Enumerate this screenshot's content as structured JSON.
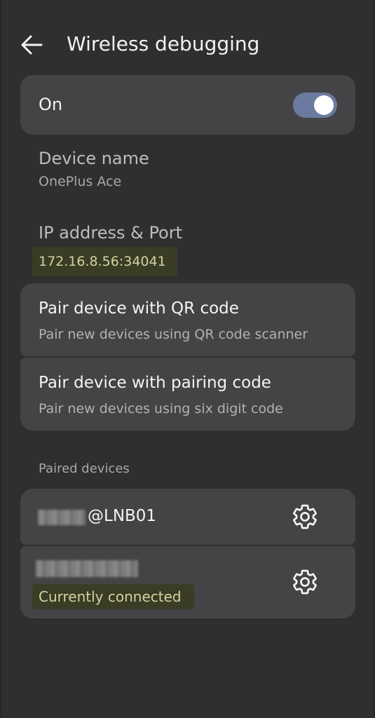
{
  "header": {
    "title": "Wireless debugging",
    "back_icon": "arrow-left-icon"
  },
  "master_switch": {
    "label": "On",
    "state": "on",
    "track_color": "#6b7a9f"
  },
  "device_name": {
    "label": "Device name",
    "value": "OnePlus Ace"
  },
  "ip_address": {
    "label": "IP address & Port",
    "value": "172.16.8.56:34041",
    "highlight_color": "#3a3c26"
  },
  "pair_options": [
    {
      "title": "Pair device with QR code",
      "subtitle": "Pair new devices using QR code scanner"
    },
    {
      "title": "Pair device with pairing code",
      "subtitle": "Pair new devices using six digit code"
    }
  ],
  "paired_devices": {
    "section_label": "Paired devices",
    "items": [
      {
        "name_visible_suffix": "@LNB01",
        "settings_icon": "gear-icon"
      },
      {
        "status": "Currently connected",
        "settings_icon": "gear-icon"
      }
    ]
  },
  "colors": {
    "background": "#2f2f30",
    "card": "#444446",
    "highlight_text": "#cfd4a0"
  }
}
